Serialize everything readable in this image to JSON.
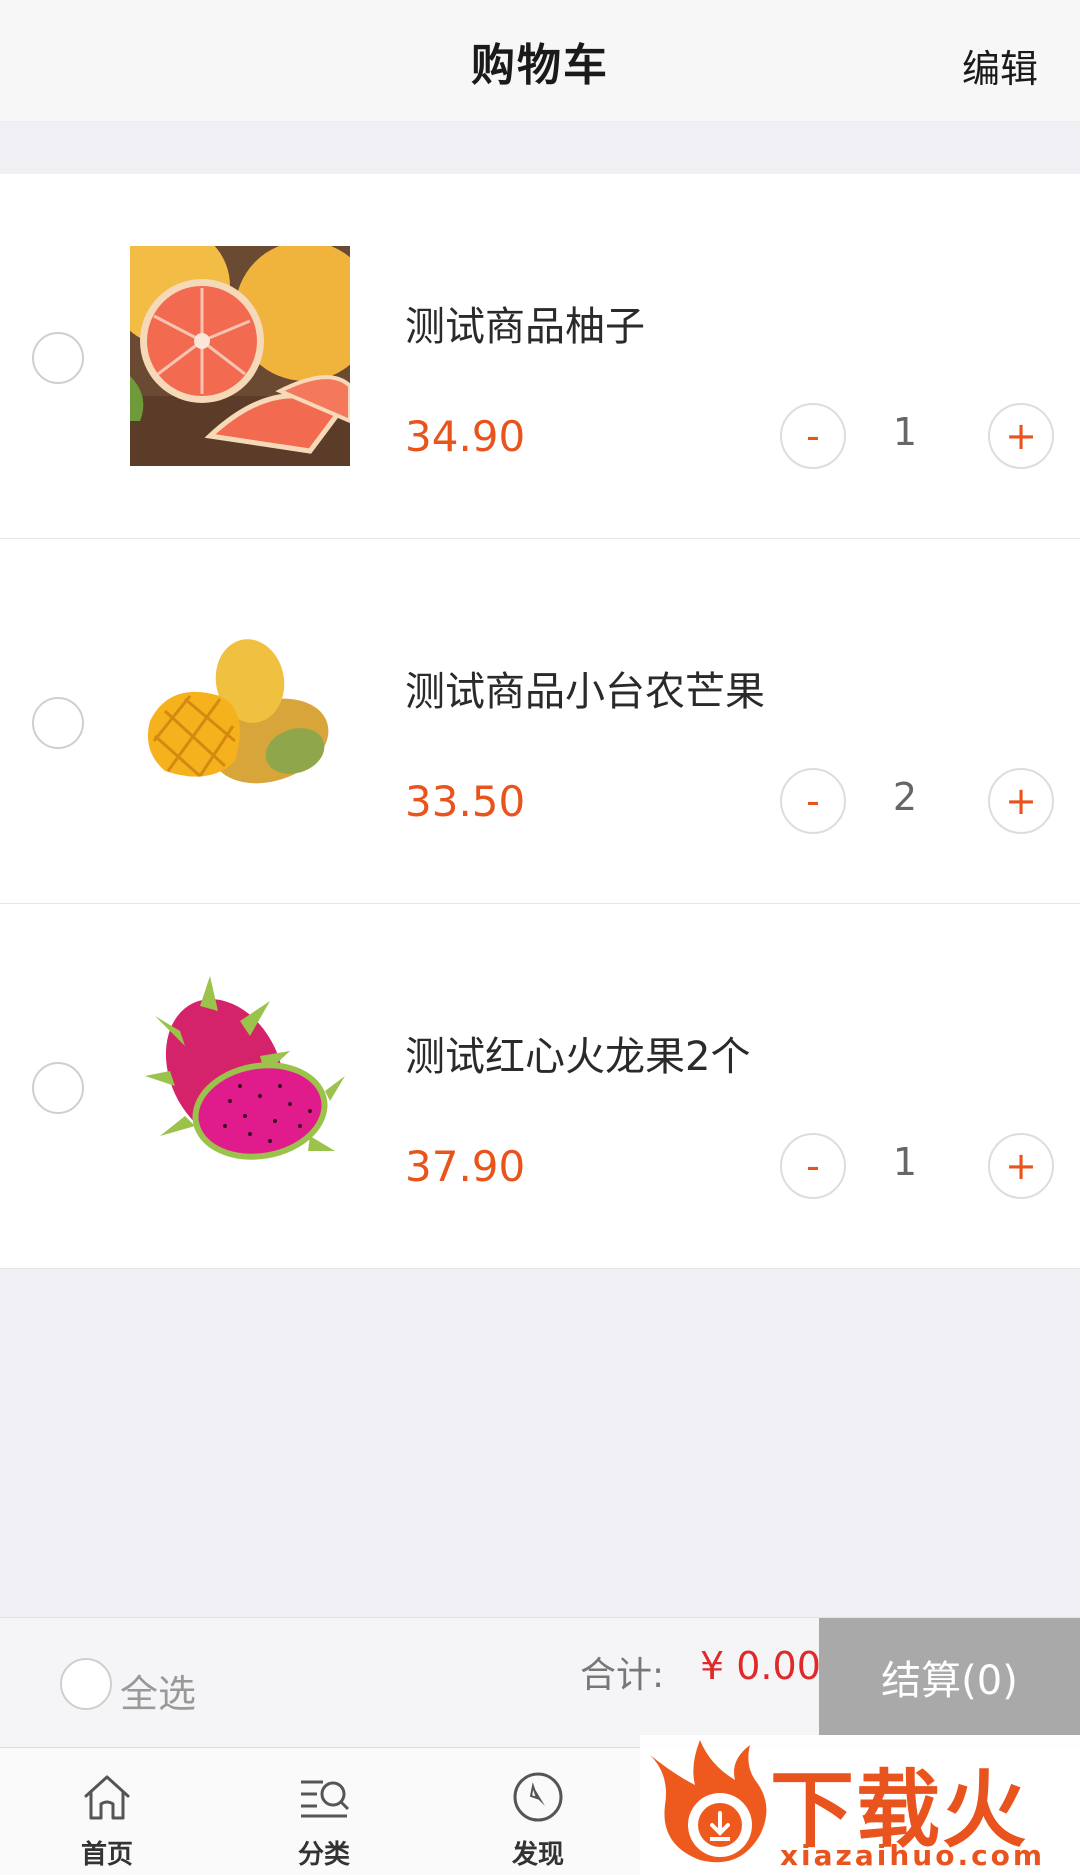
{
  "header": {
    "title": "购物车",
    "edit_label": "编辑"
  },
  "cart": {
    "items": [
      {
        "name": "测试商品柚子",
        "price": "34.90",
        "quantity": "1",
        "minus": "-",
        "plus": "+"
      },
      {
        "name": "测试商品小台农芒果",
        "price": "33.50",
        "quantity": "2",
        "minus": "-",
        "plus": "+"
      },
      {
        "name": "测试红心火龙果2个",
        "price": "37.90",
        "quantity": "1",
        "minus": "-",
        "plus": "+"
      }
    ]
  },
  "summary": {
    "select_all_label": "全选",
    "total_label": "合计:",
    "total_value": "¥ 0.00",
    "checkout_label": "结算(0)"
  },
  "tabbar": {
    "tabs": [
      {
        "label": "首页",
        "icon": "home-icon"
      },
      {
        "label": "分类",
        "icon": "category-icon"
      },
      {
        "label": "发现",
        "icon": "compass-icon"
      }
    ]
  },
  "watermark": {
    "text": "下载火",
    "subtext": "xiazaihuo.com"
  },
  "colors": {
    "price": "#e8541c",
    "total": "#e02a2a",
    "checkout_bg": "#a9a9a9",
    "background": "#f0f0f4"
  }
}
